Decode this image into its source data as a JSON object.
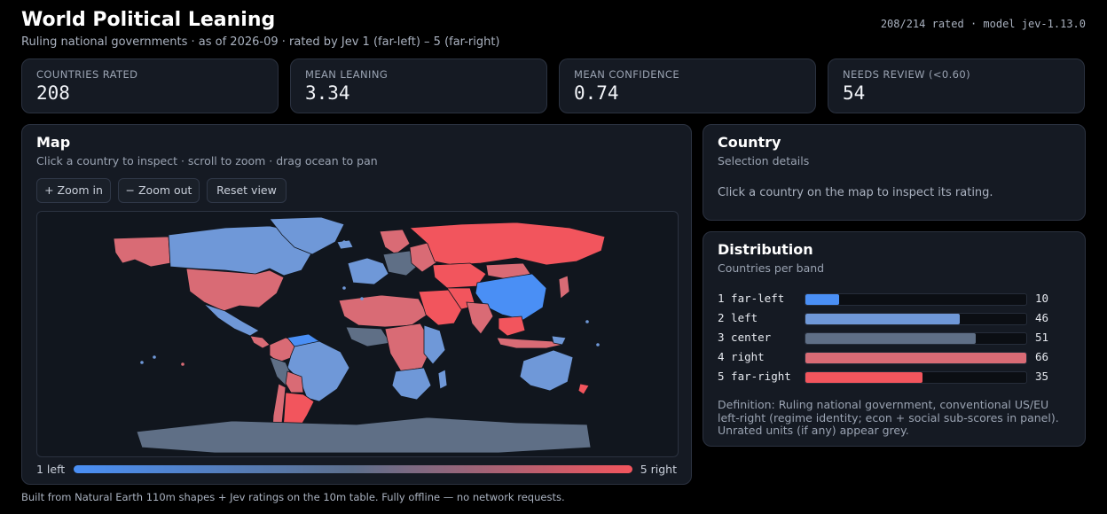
{
  "header": {
    "title": "World Political Leaning",
    "subtitle": "Ruling national governments · as of 2026-09 · rated by Jev 1 (far-left) – 5 (far-right)",
    "meta": "208/214 rated · model jev-1.13.0"
  },
  "stats": [
    {
      "label": "COUNTRIES RATED",
      "value": "208"
    },
    {
      "label": "MEAN LEANING",
      "value": "3.34"
    },
    {
      "label": "MEAN CONFIDENCE",
      "value": "0.74"
    },
    {
      "label": "NEEDS REVIEW (<0.60)",
      "value": "54"
    }
  ],
  "map": {
    "title": "Map",
    "subtitle": "Click a country to inspect · scroll to zoom · drag ocean to pan",
    "zoom_in": "+ Zoom in",
    "zoom_out": "− Zoom out",
    "reset": "Reset view",
    "legend_left": "1 left",
    "legend_right": "5 right"
  },
  "country": {
    "title": "Country",
    "subtitle": "Selection details",
    "placeholder": "Click a country on the map to inspect its rating."
  },
  "distribution": {
    "title": "Distribution",
    "subtitle": "Countries per band",
    "definition": "Definition: Ruling national government, conventional US/EU left-right (regime identity; econ + social sub-scores in panel). Unrated units (if any) appear grey.",
    "max": 66,
    "bands": [
      {
        "label": "1 far-left",
        "count": "10",
        "value": 10,
        "color": "#4a8ff5"
      },
      {
        "label": "2 left",
        "count": "46",
        "value": 46,
        "color": "#6f98d8"
      },
      {
        "label": "3 center",
        "count": "51",
        "value": 51,
        "color": "#5f6f86"
      },
      {
        "label": "4 right",
        "count": "66",
        "value": 66,
        "color": "#d96b75"
      },
      {
        "label": "5 far-right",
        "count": "35",
        "value": 35,
        "color": "#f2555d"
      }
    ]
  },
  "footer": "Built from Natural Earth 110m shapes + Jev ratings on the 10m table. Fully offline — no network requests."
}
